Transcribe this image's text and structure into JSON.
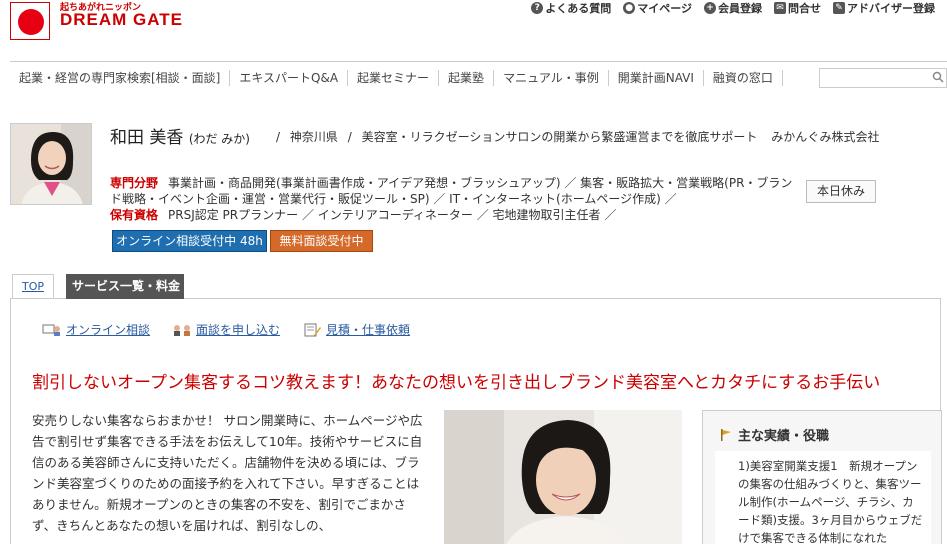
{
  "header": {
    "logo_tagline": "起ちあがれニッポン",
    "logo_name": "DREAM GATE",
    "utility": [
      {
        "icon": "question-icon",
        "label": "よくある質問"
      },
      {
        "icon": "person-icon",
        "label": "マイページ"
      },
      {
        "icon": "add-user-icon",
        "label": "会員登録"
      },
      {
        "icon": "mail-icon",
        "label": "問合せ"
      },
      {
        "icon": "pencil-icon",
        "label": "アドバイザー登録"
      }
    ]
  },
  "nav": {
    "items": [
      "起業・経営の専門家検索[相談・面談]",
      "エキスパートQ&A",
      "起業セミナー",
      "起業塾",
      "マニュアル・事例",
      "開業計画NAVI",
      "融資の窓口"
    ],
    "search_value": ""
  },
  "profile": {
    "name": "和田 美香",
    "reading": "(わだ みか)",
    "prefecture": "神奈川県",
    "summary": "美容室・リラクゼーションサロンの開業から繁盛運営までを徹底サポート",
    "company": "みかんぐみ株式会社",
    "specialty_label": "専門分野",
    "specialty_text": "事業計画・商品開発(事業計画書作成・アイデア発想・ブラッシュアップ) ／ 集客・販路拡大・営業戦略(PR・ブランド戦略・イベント企画・運営・営業代行・販促ツール・SP) ／ IT・インターネット(ホームページ作成) ／",
    "qualification_label": "保有資格",
    "qualification_text": "PRSJ認定 PRプランナー ／ インテリアコーディネーター ／ 宅地建物取引主任者 ／",
    "holiday": "本日休み",
    "online_button": "オンライン相談受付中 48h",
    "free_button": "無料面談受付中"
  },
  "tabs": {
    "top": "TOP",
    "service": "サービス一覧・料金"
  },
  "sublinks": [
    {
      "icon": "online-consult-icon",
      "label": "オンライン相談"
    },
    {
      "icon": "meeting-icon",
      "label": "面談を申し込む"
    },
    {
      "icon": "estimate-icon",
      "label": "見積・仕事依頼"
    }
  ],
  "main": {
    "headline": "割引しないオープン集客するコツ教えます！あなたの想いを引き出しブランド美容室へとカタチにするお手伝い",
    "body": "安売りしない集客ならおまかせ！ サロン開業時に、ホームページや広告で割引せず集客できる手法をお伝えして10年。技術やサービスに自信のある美容師さんに支持いただく。店舗物件を決める頃には、ブランド美容室づくりのための面接予約を入れて下さい。早すぎることはありません。新規オープンのときの集客の不安を、割引でごまかさず、きちんとあなたの想いを届ければ、割引なしの、"
  },
  "side": {
    "title": "主な実績・役職",
    "text": "1)美容室開業支援1　新規オープンの集客の仕組みづくりと、集客ツール制作(ホームページ、チラシ、カード類)支援。3ヶ月目からウェブだけで集客できる体制になれた"
  },
  "colors": {
    "brand_red": "#e60012",
    "link_blue": "#2a5aa0",
    "online_blue": "#1f6fb0",
    "free_orange": "#d4692a"
  }
}
